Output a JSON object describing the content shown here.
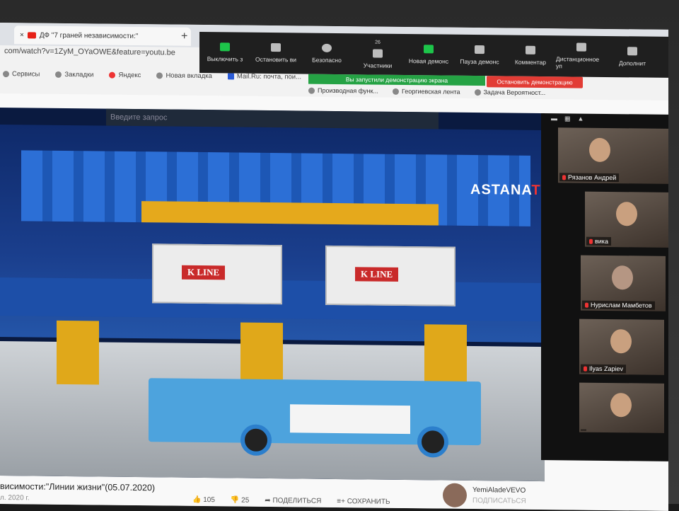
{
  "browser": {
    "tab_title": "ДФ \"7 граней независимости:\"",
    "new_tab": "+",
    "close_tab": "×",
    "url": "com/watch?v=1ZyM_OYaOWE&feature=youtu.be",
    "bookmarks": [
      "Сервисы",
      "Закладки",
      "Яндекс",
      "Новая вкладка",
      "Mail.Ru: почта, пои..."
    ],
    "bookmarks_right": [
      "Производная функ...",
      "Георгиевская лента",
      "Задача Вероятност..."
    ]
  },
  "zoom_toolbar": {
    "buttons": [
      {
        "label": "Выключить з"
      },
      {
        "label": "Остановить ви"
      },
      {
        "label": "Безопасно"
      },
      {
        "label": "Участники",
        "badge": "26"
      },
      {
        "label": "Новая демонс"
      },
      {
        "label": "Пауза демонс"
      },
      {
        "label": "Комментар"
      },
      {
        "label": "Дистанционное уп"
      },
      {
        "label": "Дополнит"
      }
    ],
    "share_banner": "Вы запустили демонстрацию экрана",
    "stop_share": "Остановить демонстрацию"
  },
  "youtube": {
    "search_placeholder": "Введите запрос",
    "watermark": "ASTANA",
    "watermark_suffix": "TV",
    "container_text": "K LINE",
    "video_title": "висимости:\"Линии жизни\"(05.07.2020)",
    "video_date": "л. 2020 г.",
    "likes": "105",
    "dislikes": "25",
    "share": "ПОДЕЛИТЬСЯ",
    "save": "СОХРАНИТЬ",
    "channel_name": "YemiAlade​VEVO",
    "subscribe": "ПОДПИСАТЬСЯ"
  },
  "participants": [
    {
      "name": "Рязанов Андрей"
    },
    {
      "name": "вика"
    },
    {
      "name": "Нурислам Мамбетов"
    },
    {
      "name": "Ilyas Zapiev"
    },
    {
      "name": ""
    }
  ]
}
